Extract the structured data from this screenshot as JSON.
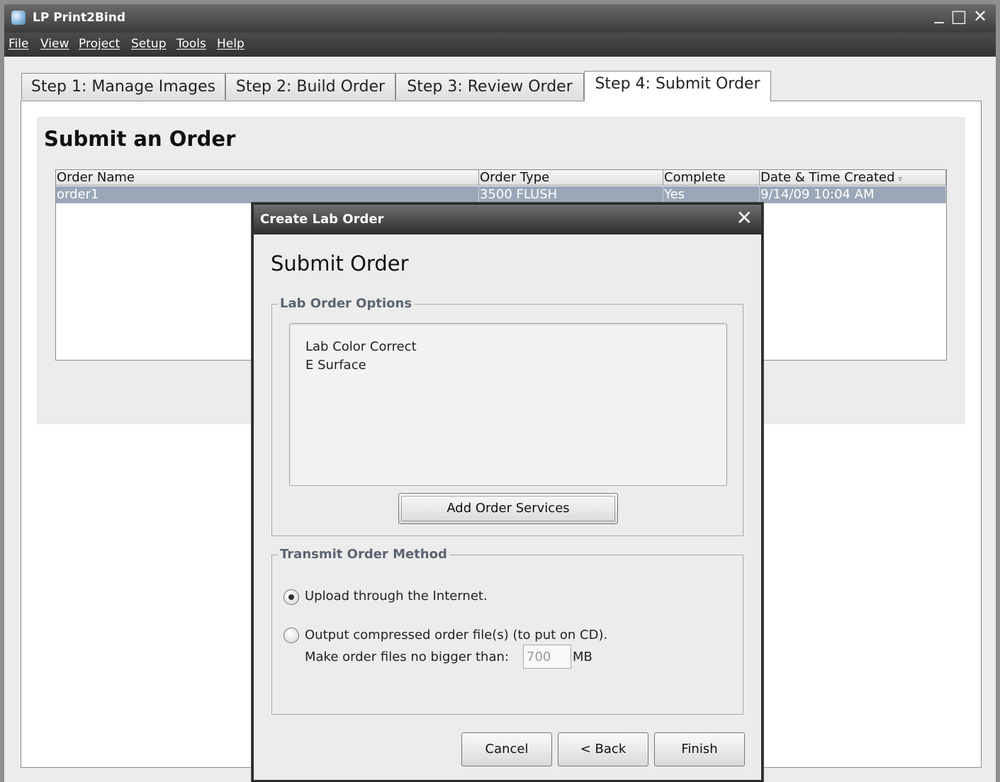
{
  "app": {
    "title": "LP Print2Bind"
  },
  "window_controls": {
    "minimize": "_",
    "maximize": "□",
    "close": "✕"
  },
  "menu": [
    "File",
    "View",
    "Project",
    "Setup",
    "Tools",
    "Help"
  ],
  "tabs": [
    {
      "label": "Step 1: Manage Images",
      "active": false
    },
    {
      "label": "Step 2: Build Order",
      "active": false
    },
    {
      "label": "Step 3: Review Order",
      "active": false
    },
    {
      "label": "Step 4: Submit Order",
      "active": true
    }
  ],
  "main": {
    "heading": "Submit an Order",
    "table": {
      "columns": [
        "Order Name",
        "Order Type",
        "Complete",
        "Date & Time Created"
      ],
      "sort_indicator": "▿",
      "rows": [
        [
          "order1",
          "3500 FLUSH",
          "Yes",
          "9/14/09 10:04 AM"
        ]
      ]
    }
  },
  "dialog": {
    "title": "Create Lab Order",
    "close": "✕",
    "heading": "Submit Order",
    "lab_options": {
      "legend": "Lab Order Options",
      "items": [
        "Lab Color Correct",
        "E Surface"
      ],
      "add_button": "Add Order Services"
    },
    "transmit": {
      "legend": "Transmit Order Method",
      "upload_label": "Upload through the Internet.",
      "upload_selected": true,
      "output_label": "Output compressed order file(s) (to put on CD).",
      "output_selected": false,
      "size_label": "Make order files no bigger than:",
      "size_value": "700",
      "size_unit": "MB"
    },
    "buttons": {
      "cancel": "Cancel",
      "back": "< Back",
      "finish": "Finish"
    }
  },
  "colors": {
    "selection_row": "#9aa7b8",
    "legend_text": "#5a6472",
    "titlebar": "#3c3c3c"
  }
}
